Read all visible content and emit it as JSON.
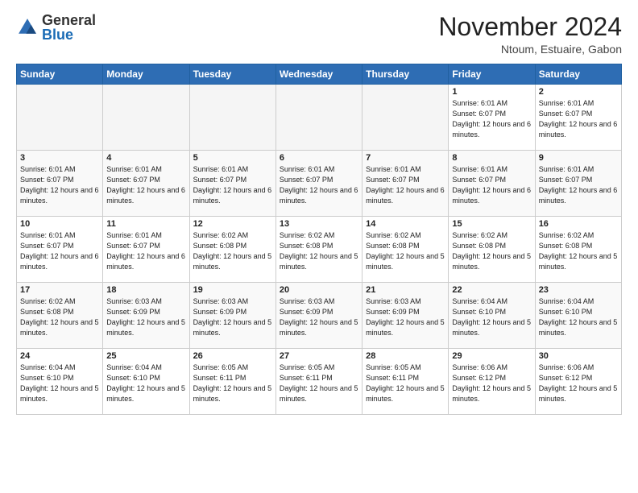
{
  "logo": {
    "general": "General",
    "blue": "Blue"
  },
  "header": {
    "title": "November 2024",
    "location": "Ntoum, Estuaire, Gabon"
  },
  "days_of_week": [
    "Sunday",
    "Monday",
    "Tuesday",
    "Wednesday",
    "Thursday",
    "Friday",
    "Saturday"
  ],
  "weeks": [
    [
      {
        "day": "",
        "info": ""
      },
      {
        "day": "",
        "info": ""
      },
      {
        "day": "",
        "info": ""
      },
      {
        "day": "",
        "info": ""
      },
      {
        "day": "",
        "info": ""
      },
      {
        "day": "1",
        "info": "Sunrise: 6:01 AM\nSunset: 6:07 PM\nDaylight: 12 hours\nand 6 minutes."
      },
      {
        "day": "2",
        "info": "Sunrise: 6:01 AM\nSunset: 6:07 PM\nDaylight: 12 hours\nand 6 minutes."
      }
    ],
    [
      {
        "day": "3",
        "info": "Sunrise: 6:01 AM\nSunset: 6:07 PM\nDaylight: 12 hours\nand 6 minutes."
      },
      {
        "day": "4",
        "info": "Sunrise: 6:01 AM\nSunset: 6:07 PM\nDaylight: 12 hours\nand 6 minutes."
      },
      {
        "day": "5",
        "info": "Sunrise: 6:01 AM\nSunset: 6:07 PM\nDaylight: 12 hours\nand 6 minutes."
      },
      {
        "day": "6",
        "info": "Sunrise: 6:01 AM\nSunset: 6:07 PM\nDaylight: 12 hours\nand 6 minutes."
      },
      {
        "day": "7",
        "info": "Sunrise: 6:01 AM\nSunset: 6:07 PM\nDaylight: 12 hours\nand 6 minutes."
      },
      {
        "day": "8",
        "info": "Sunrise: 6:01 AM\nSunset: 6:07 PM\nDaylight: 12 hours\nand 6 minutes."
      },
      {
        "day": "9",
        "info": "Sunrise: 6:01 AM\nSunset: 6:07 PM\nDaylight: 12 hours\nand 6 minutes."
      }
    ],
    [
      {
        "day": "10",
        "info": "Sunrise: 6:01 AM\nSunset: 6:07 PM\nDaylight: 12 hours\nand 6 minutes."
      },
      {
        "day": "11",
        "info": "Sunrise: 6:01 AM\nSunset: 6:07 PM\nDaylight: 12 hours\nand 6 minutes."
      },
      {
        "day": "12",
        "info": "Sunrise: 6:02 AM\nSunset: 6:08 PM\nDaylight: 12 hours\nand 5 minutes."
      },
      {
        "day": "13",
        "info": "Sunrise: 6:02 AM\nSunset: 6:08 PM\nDaylight: 12 hours\nand 5 minutes."
      },
      {
        "day": "14",
        "info": "Sunrise: 6:02 AM\nSunset: 6:08 PM\nDaylight: 12 hours\nand 5 minutes."
      },
      {
        "day": "15",
        "info": "Sunrise: 6:02 AM\nSunset: 6:08 PM\nDaylight: 12 hours\nand 5 minutes."
      },
      {
        "day": "16",
        "info": "Sunrise: 6:02 AM\nSunset: 6:08 PM\nDaylight: 12 hours\nand 5 minutes."
      }
    ],
    [
      {
        "day": "17",
        "info": "Sunrise: 6:02 AM\nSunset: 6:08 PM\nDaylight: 12 hours\nand 5 minutes."
      },
      {
        "day": "18",
        "info": "Sunrise: 6:03 AM\nSunset: 6:09 PM\nDaylight: 12 hours\nand 5 minutes."
      },
      {
        "day": "19",
        "info": "Sunrise: 6:03 AM\nSunset: 6:09 PM\nDaylight: 12 hours\nand 5 minutes."
      },
      {
        "day": "20",
        "info": "Sunrise: 6:03 AM\nSunset: 6:09 PM\nDaylight: 12 hours\nand 5 minutes."
      },
      {
        "day": "21",
        "info": "Sunrise: 6:03 AM\nSunset: 6:09 PM\nDaylight: 12 hours\nand 5 minutes."
      },
      {
        "day": "22",
        "info": "Sunrise: 6:04 AM\nSunset: 6:10 PM\nDaylight: 12 hours\nand 5 minutes."
      },
      {
        "day": "23",
        "info": "Sunrise: 6:04 AM\nSunset: 6:10 PM\nDaylight: 12 hours\nand 5 minutes."
      }
    ],
    [
      {
        "day": "24",
        "info": "Sunrise: 6:04 AM\nSunset: 6:10 PM\nDaylight: 12 hours\nand 5 minutes."
      },
      {
        "day": "25",
        "info": "Sunrise: 6:04 AM\nSunset: 6:10 PM\nDaylight: 12 hours\nand 5 minutes."
      },
      {
        "day": "26",
        "info": "Sunrise: 6:05 AM\nSunset: 6:11 PM\nDaylight: 12 hours\nand 5 minutes."
      },
      {
        "day": "27",
        "info": "Sunrise: 6:05 AM\nSunset: 6:11 PM\nDaylight: 12 hours\nand 5 minutes."
      },
      {
        "day": "28",
        "info": "Sunrise: 6:05 AM\nSunset: 6:11 PM\nDaylight: 12 hours\nand 5 minutes."
      },
      {
        "day": "29",
        "info": "Sunrise: 6:06 AM\nSunset: 6:12 PM\nDaylight: 12 hours\nand 5 minutes."
      },
      {
        "day": "30",
        "info": "Sunrise: 6:06 AM\nSunset: 6:12 PM\nDaylight: 12 hours\nand 5 minutes."
      }
    ]
  ]
}
